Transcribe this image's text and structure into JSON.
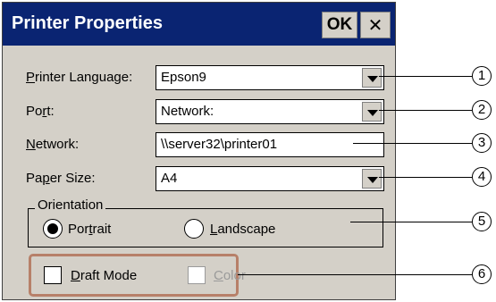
{
  "window": {
    "title": "Printer Properties",
    "ok_label": "OK",
    "close_symbol": "✕"
  },
  "fields": {
    "printer_language": {
      "label_prefix": "P",
      "label_rest": "rinter Language:",
      "value": "Epson9"
    },
    "port": {
      "label_a": "Po",
      "label_u": "r",
      "label_b": "t:",
      "value": "Network:"
    },
    "network": {
      "label_u": "N",
      "label_rest": "etwork:",
      "value": "\\\\server32\\printer01"
    },
    "paper_size": {
      "label_a": "Pa",
      "label_u": "p",
      "label_b": "er Size:",
      "value": "A4"
    }
  },
  "orientation": {
    "legend": "Orientation",
    "portrait": {
      "label_a": "Por",
      "label_u": "t",
      "label_b": "rait",
      "selected": true
    },
    "landscape": {
      "label_u": "L",
      "label_rest": "andscape",
      "selected": false
    }
  },
  "options": {
    "draft_mode": {
      "label_u": "D",
      "label_rest": "raft Mode",
      "checked": false
    },
    "color": {
      "label_u": "C",
      "label_rest": "olor",
      "checked": false,
      "disabled": true
    }
  },
  "callouts": [
    "1",
    "2",
    "3",
    "4",
    "5",
    "6"
  ],
  "colors": {
    "titlebar": "#0a2472",
    "dialog_bg": "#d4d0c8",
    "highlight_border": "#b78069"
  },
  "icons": {
    "dropdown": "triangle-down-icon",
    "close": "close-icon"
  }
}
